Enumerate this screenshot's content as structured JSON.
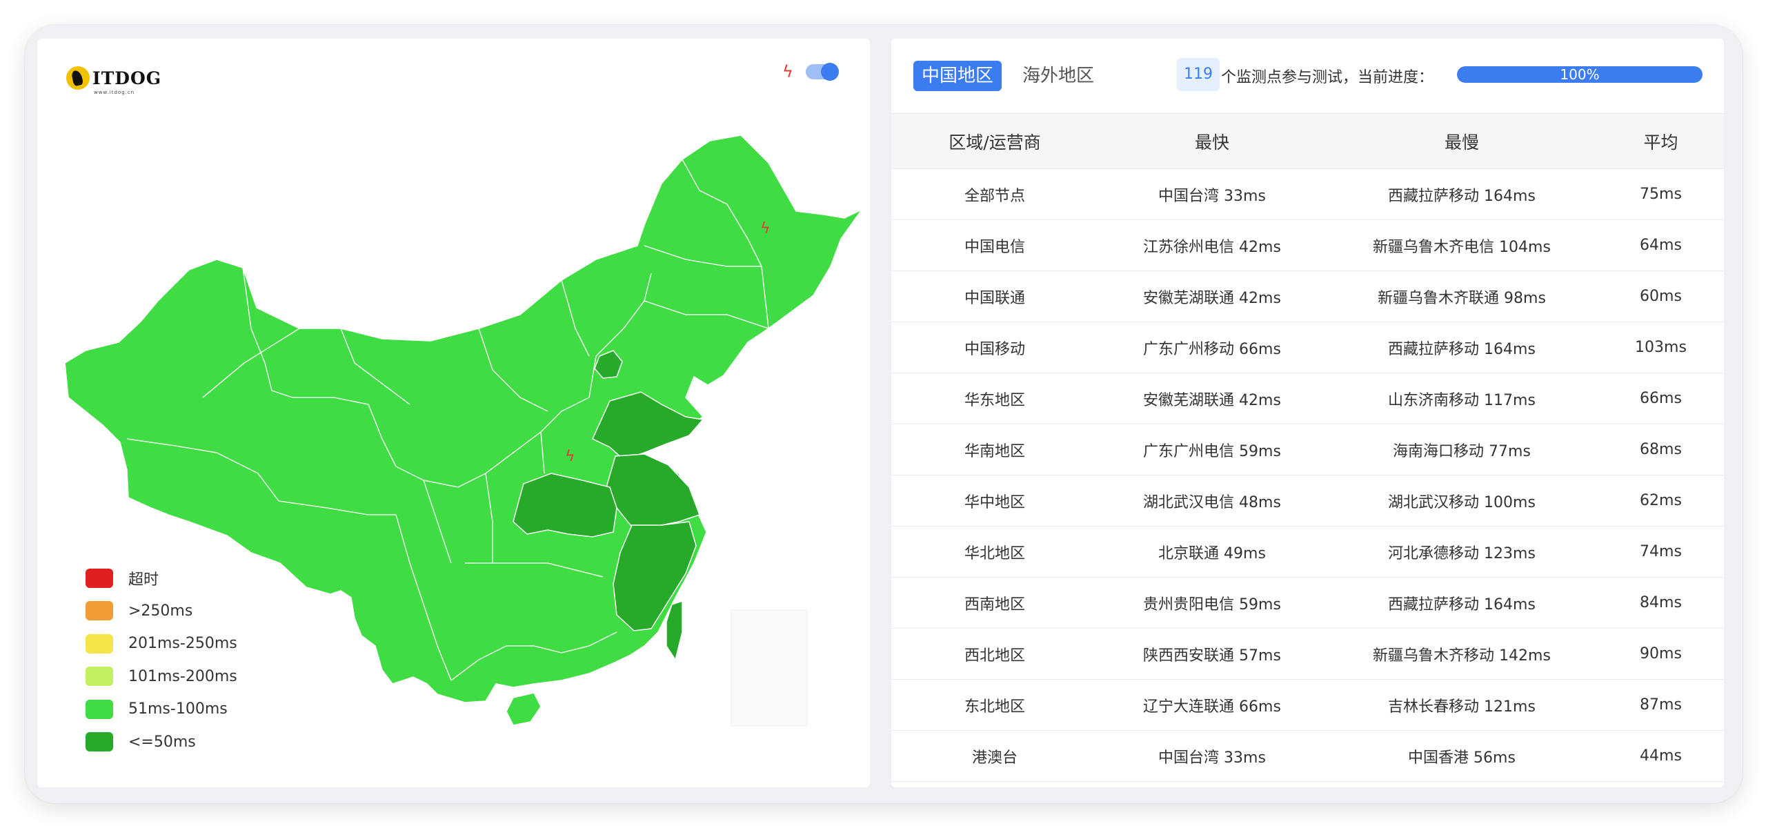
{
  "brand": {
    "name": "ITDOG",
    "sub": "www.itdog.cn"
  },
  "map": {
    "icons": [
      "lightning-icon"
    ],
    "legend": [
      {
        "label": "超时",
        "color": "#e02020"
      },
      {
        "label": ">250ms",
        "color": "#f39c36"
      },
      {
        "label": "201ms-250ms",
        "color": "#f5e44a"
      },
      {
        "label": "101ms-200ms",
        "color": "#c2f062"
      },
      {
        "label": "51ms-100ms",
        "color": "#40dc44"
      },
      {
        "label": "<=50ms",
        "color": "#27a92a"
      }
    ]
  },
  "tabs": {
    "china": "中国地区",
    "overseas": "海外地区"
  },
  "progress": {
    "count": "119",
    "text": "个监测点参与测试，当前进度：",
    "percent_label": "100%",
    "fraction": 1.0
  },
  "table": {
    "headers": [
      "区域/运营商",
      "最快",
      "最慢",
      "平均"
    ],
    "rows": [
      [
        "全部节点",
        "中国台湾 33ms",
        "西藏拉萨移动 164ms",
        "75ms"
      ],
      [
        "中国电信",
        "江苏徐州电信 42ms",
        "新疆乌鲁木齐电信 104ms",
        "64ms"
      ],
      [
        "中国联通",
        "安徽芜湖联通 42ms",
        "新疆乌鲁木齐联通 98ms",
        "60ms"
      ],
      [
        "中国移动",
        "广东广州移动 66ms",
        "西藏拉萨移动 164ms",
        "103ms"
      ],
      [
        "华东地区",
        "安徽芜湖联通 42ms",
        "山东济南移动 117ms",
        "66ms"
      ],
      [
        "华南地区",
        "广东广州电信 59ms",
        "海南海口移动 77ms",
        "68ms"
      ],
      [
        "华中地区",
        "湖北武汉电信 48ms",
        "湖北武汉移动 100ms",
        "62ms"
      ],
      [
        "华北地区",
        "北京联通 49ms",
        "河北承德移动 123ms",
        "74ms"
      ],
      [
        "西南地区",
        "贵州贵阳电信 59ms",
        "西藏拉萨移动 164ms",
        "84ms"
      ],
      [
        "西北地区",
        "陕西西安联通 57ms",
        "新疆乌鲁木齐移动 142ms",
        "90ms"
      ],
      [
        "东北地区",
        "辽宁大连联通 66ms",
        "吉林长春移动 121ms",
        "87ms"
      ],
      [
        "港澳台",
        "中国台湾 33ms",
        "中国香港 56ms",
        "44ms"
      ]
    ]
  },
  "colors": {
    "accent": "#3b7cf0",
    "map_base": "#40dc44",
    "map_fast": "#27a92a"
  }
}
